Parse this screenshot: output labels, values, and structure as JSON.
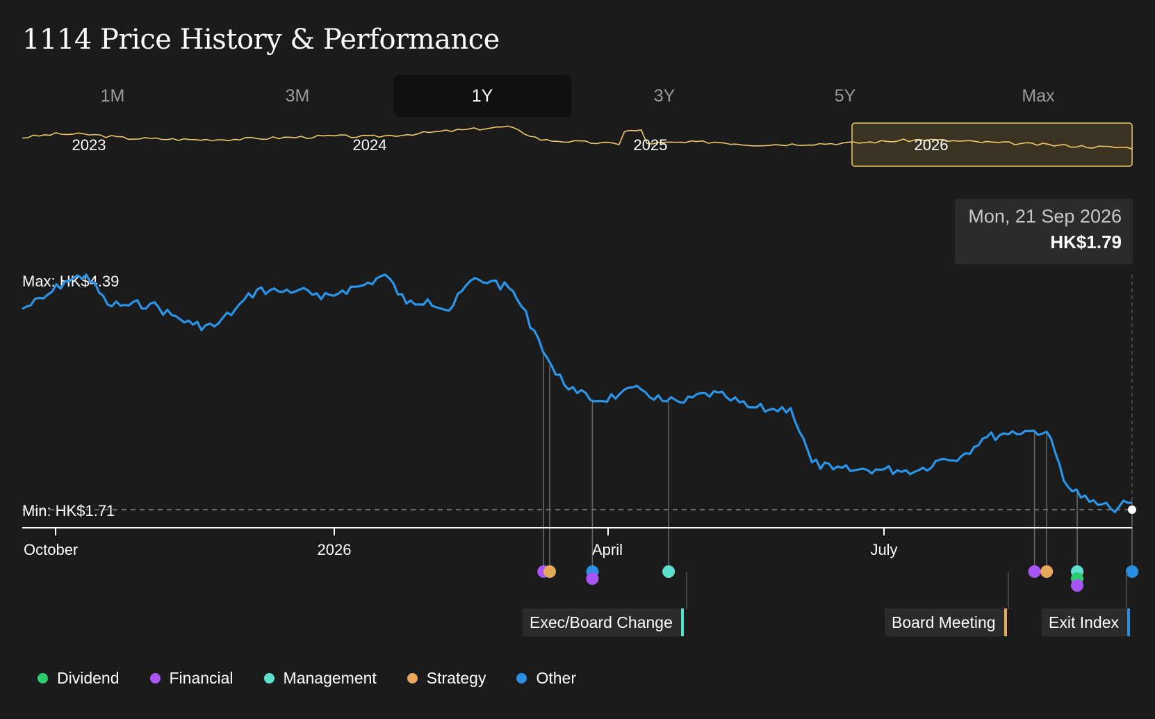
{
  "title": "1114 Price History & Performance",
  "tabs": [
    {
      "label": "1M",
      "active": false
    },
    {
      "label": "3M",
      "active": false
    },
    {
      "label": "1Y",
      "active": true
    },
    {
      "label": "3Y",
      "active": false
    },
    {
      "label": "5Y",
      "active": false
    },
    {
      "label": "Max",
      "active": false
    }
  ],
  "overview": {
    "year_labels": [
      "2023",
      "2024",
      "2025",
      "2026"
    ],
    "selected_range": "1Y",
    "color": "#f2c96a"
  },
  "tooltip": {
    "date": "Mon, 21 Sep 2026",
    "price": "HK$1.79"
  },
  "max_label": "Max: HK$4.39",
  "min_label": "Min: HK$1.71",
  "events": [
    {
      "label": "Exec/Board Change",
      "category": "Management"
    },
    {
      "label": "Board Meeting",
      "category": "Strategy"
    },
    {
      "label": "Exit Index",
      "category": "Other"
    }
  ],
  "legend": [
    {
      "label": "Dividend",
      "color": "#2ecc71"
    },
    {
      "label": "Financial",
      "color": "#a855f7"
    },
    {
      "label": "Management",
      "color": "#5fe0cc"
    },
    {
      "label": "Strategy",
      "color": "#e8a85a"
    },
    {
      "label": "Other",
      "color": "#2a8fe0"
    }
  ],
  "chart_data": {
    "type": "line",
    "series": [
      {
        "color": "#2a95e8",
        "x": [
          "2025-09-22",
          "2025-09-29",
          "2025-10-06",
          "2025-10-13",
          "2025-10-20",
          "2025-10-27",
          "2025-11-03",
          "2025-11-10",
          "2025-11-17",
          "2025-11-24",
          "2025-12-01",
          "2025-12-08",
          "2025-12-15",
          "2025-12-22",
          "2025-12-29",
          "2026-01-05",
          "2026-01-12",
          "2026-01-19",
          "2026-01-26",
          "2026-02-02",
          "2026-02-09",
          "2026-02-16",
          "2026-02-23",
          "2026-03-02",
          "2026-03-09",
          "2026-03-16",
          "2026-03-23",
          "2026-03-30",
          "2026-04-06",
          "2026-04-13",
          "2026-04-20",
          "2026-04-27",
          "2026-05-04",
          "2026-05-11",
          "2026-05-18",
          "2026-05-25",
          "2026-06-01",
          "2026-06-08",
          "2026-06-15",
          "2026-06-22",
          "2026-06-29",
          "2026-07-06",
          "2026-07-13",
          "2026-07-20",
          "2026-07-27",
          "2026-08-03",
          "2026-08-10",
          "2026-08-17",
          "2026-08-24",
          "2026-08-31",
          "2026-09-07",
          "2026-09-14",
          "2026-09-21"
        ],
        "values": [
          4.0,
          4.12,
          4.31,
          4.39,
          4.05,
          4.04,
          4.06,
          3.93,
          3.82,
          3.8,
          4.0,
          4.22,
          4.2,
          4.22,
          4.11,
          4.21,
          4.27,
          4.39,
          4.06,
          4.11,
          3.98,
          4.32,
          4.32,
          4.2,
          3.75,
          3.25,
          3.04,
          2.95,
          3.03,
          3.08,
          2.95,
          2.93,
          3.04,
          2.99,
          2.88,
          2.85,
          2.87,
          2.25,
          2.17,
          2.16,
          2.17,
          2.16,
          2.16,
          2.28,
          2.32,
          2.52,
          2.58,
          2.61,
          2.6,
          1.97,
          1.8,
          1.72,
          1.79
        ]
      }
    ],
    "x_ticks": [
      "October",
      "2026",
      "April",
      "July"
    ],
    "ylim": [
      1.6,
      4.5
    ],
    "max": 4.39,
    "min": 1.71,
    "grid": false,
    "legend_position": "bottom-left",
    "event_markers": [
      {
        "date": "2026-03-12",
        "category": "Financial"
      },
      {
        "date": "2026-03-14",
        "category": "Strategy"
      },
      {
        "date": "2026-03-28",
        "category": "Other"
      },
      {
        "date": "2026-03-28",
        "category": "Financial"
      },
      {
        "date": "2026-04-22",
        "category": "Management"
      },
      {
        "date": "2026-08-20",
        "category": "Financial"
      },
      {
        "date": "2026-08-24",
        "category": "Strategy"
      },
      {
        "date": "2026-09-03",
        "category": "Management"
      },
      {
        "date": "2026-09-03",
        "category": "Dividend"
      },
      {
        "date": "2026-09-03",
        "category": "Financial"
      },
      {
        "date": "2026-09-21",
        "category": "Other"
      }
    ]
  }
}
